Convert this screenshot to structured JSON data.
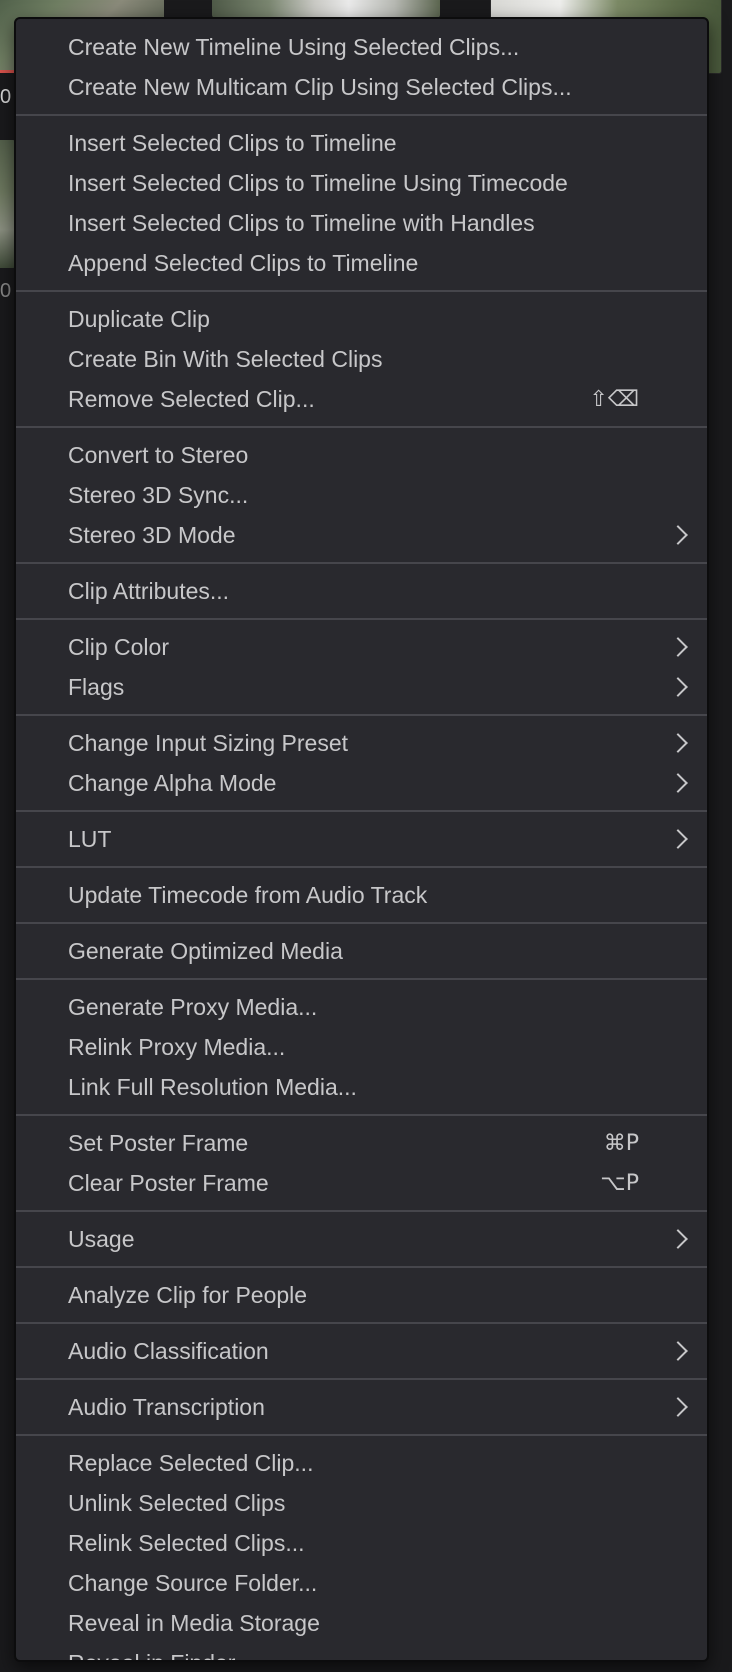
{
  "background": {
    "digits": [
      "0",
      "0"
    ]
  },
  "menu": {
    "groups": [
      [
        {
          "label": "Create New Timeline Using Selected Clips..."
        },
        {
          "label": "Create New Multicam Clip Using Selected Clips..."
        }
      ],
      [
        {
          "label": "Insert Selected Clips to Timeline"
        },
        {
          "label": "Insert Selected Clips to Timeline Using Timecode"
        },
        {
          "label": "Insert Selected Clips to Timeline with Handles"
        },
        {
          "label": "Append Selected Clips to Timeline"
        }
      ],
      [
        {
          "label": "Duplicate Clip"
        },
        {
          "label": "Create Bin With Selected Clips"
        },
        {
          "label": "Remove Selected Clip...",
          "shortcut": "⇧⌫"
        }
      ],
      [
        {
          "label": "Convert to Stereo"
        },
        {
          "label": "Stereo 3D Sync..."
        },
        {
          "label": "Stereo 3D Mode",
          "submenu": true
        }
      ],
      [
        {
          "label": "Clip Attributes..."
        }
      ],
      [
        {
          "label": "Clip Color",
          "submenu": true
        },
        {
          "label": "Flags",
          "submenu": true
        }
      ],
      [
        {
          "label": "Change Input Sizing Preset",
          "submenu": true
        },
        {
          "label": "Change Alpha Mode",
          "submenu": true
        }
      ],
      [
        {
          "label": "LUT",
          "submenu": true
        }
      ],
      [
        {
          "label": "Update Timecode from Audio Track"
        }
      ],
      [
        {
          "label": "Generate Optimized Media"
        }
      ],
      [
        {
          "label": "Generate Proxy Media..."
        },
        {
          "label": "Relink Proxy Media..."
        },
        {
          "label": "Link Full Resolution Media..."
        }
      ],
      [
        {
          "label": "Set Poster Frame",
          "shortcut": "⌘P"
        },
        {
          "label": "Clear Poster Frame",
          "shortcut": "⌥P"
        }
      ],
      [
        {
          "label": "Usage",
          "submenu": true
        }
      ],
      [
        {
          "label": "Analyze Clip for People"
        }
      ],
      [
        {
          "label": "Audio Classification",
          "submenu": true
        }
      ],
      [
        {
          "label": "Audio Transcription",
          "submenu": true
        }
      ],
      [
        {
          "label": "Replace Selected Clip..."
        },
        {
          "label": "Unlink Selected Clips"
        },
        {
          "label": "Relink Selected Clips..."
        },
        {
          "label": "Change Source Folder..."
        },
        {
          "label": "Reveal in Media Storage"
        },
        {
          "label": "Reveal in Finder"
        }
      ]
    ]
  }
}
